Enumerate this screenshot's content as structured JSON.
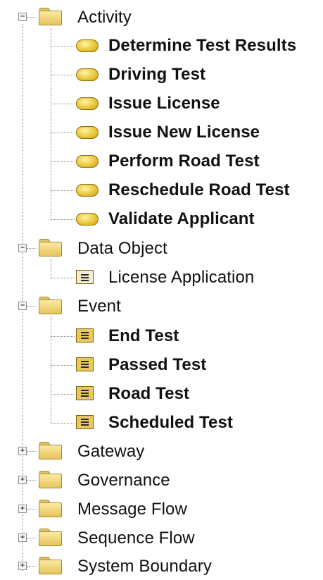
{
  "tree": {
    "activity": {
      "label": "Activity",
      "expander": "−",
      "children": [
        "Determine Test Results",
        "Driving Test",
        "Issue License",
        "Issue New License",
        "Perform Road Test",
        "Reschedule Road Test",
        "Validate Applicant"
      ]
    },
    "data_object": {
      "label": "Data Object",
      "expander": "−",
      "children": [
        "License Application"
      ]
    },
    "event": {
      "label": "Event",
      "expander": "−",
      "children": [
        "End Test",
        "Passed Test",
        "Road Test",
        "Scheduled Test"
      ]
    },
    "collapsed": [
      {
        "label": "Gateway",
        "expander": "+"
      },
      {
        "label": "Governance",
        "expander": "+"
      },
      {
        "label": "Message Flow",
        "expander": "+"
      },
      {
        "label": "Sequence Flow",
        "expander": "+"
      },
      {
        "label": "System Boundary",
        "expander": "+"
      }
    ]
  },
  "colors": {
    "folder": "#e6c45a",
    "activity_pill": "#e8c433",
    "event_icon": "#e9c85c",
    "tree_lines": "#8a8a8a"
  },
  "icons": {
    "folder": "folder-icon",
    "activity": "activity-pill-icon",
    "event": "event-list-icon"
  }
}
